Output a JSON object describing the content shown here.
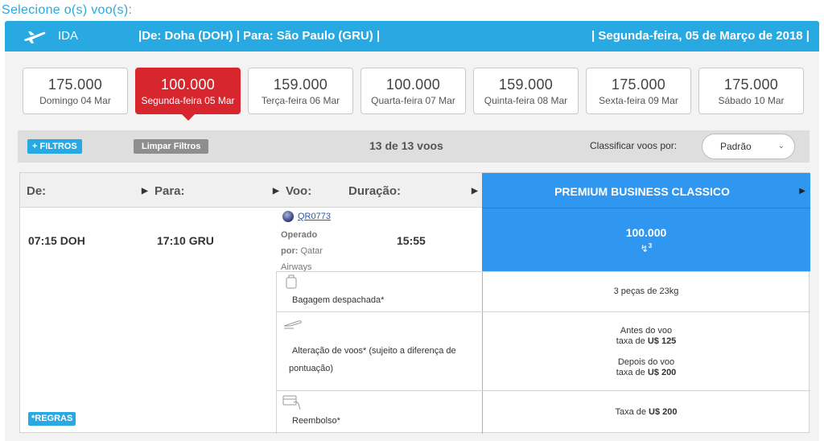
{
  "page": {
    "title": "Selecione o(s) voo(s):"
  },
  "route": {
    "direction": "IDA",
    "route_text": "|De: Doha (DOH) | Para: São Paulo (GRU) |",
    "date_text": "| Segunda-feira, 05 de Março de 2018 |"
  },
  "dates": [
    {
      "price": "175.000",
      "day": "Domingo 04 Mar"
    },
    {
      "price": "100.000",
      "day": "Segunda-feira 05 Mar"
    },
    {
      "price": "159.000",
      "day": "Terça-feira 06 Mar"
    },
    {
      "price": "100.000",
      "day": "Quarta-feira 07 Mar"
    },
    {
      "price": "159.000",
      "day": "Quinta-feira 08 Mar"
    },
    {
      "price": "175.000",
      "day": "Sexta-feira 09 Mar"
    },
    {
      "price": "175.000",
      "day": "Sábado 10 Mar"
    }
  ],
  "selected_date_index": 1,
  "filters": {
    "filtros_label": "+ FILTROS",
    "limpar_label": "Limpar Filtros",
    "count": "13 de 13 voos",
    "sort_label": "Classificar voos por:",
    "sort_value": "Padrão"
  },
  "table": {
    "headers": {
      "from": "De:",
      "to": "Para:",
      "flight": "Voo:",
      "duration": "Duração:"
    },
    "fare_class": "PREMIUM BUSINESS CLASSICO",
    "flight": {
      "departure": "07:15 DOH",
      "arrival": "17:10 GRU",
      "duration": "15:55",
      "number": "QR0773",
      "operated_1": "Operado",
      "operated_2_bold": "por:",
      "operated_2": " Qatar",
      "operated_3": "Airways",
      "points": "100.000",
      "seats": "3"
    },
    "rules": {
      "baggage_label": "Bagagem despachada*",
      "baggage_value": "3 peças de 23kg",
      "change_label_1": "Alteração de voos* (sujeito a diferença de",
      "change_label_2": "pontuação)",
      "change_before_1": "Antes do voo",
      "change_before_2": "taxa de ",
      "change_before_fee": "U$ 125",
      "change_after_1": "Depois do voo",
      "change_after_2": "taxa de ",
      "change_after_fee": "U$ 200",
      "refund_label": "Reembolso*",
      "refund_value": "Taxa de ",
      "refund_fee": "U$ 200"
    },
    "regras_label": "*REGRAS"
  },
  "colors": {
    "accent": "#29a9e1",
    "selected": "#d7262e",
    "fare": "#2f97f0"
  }
}
